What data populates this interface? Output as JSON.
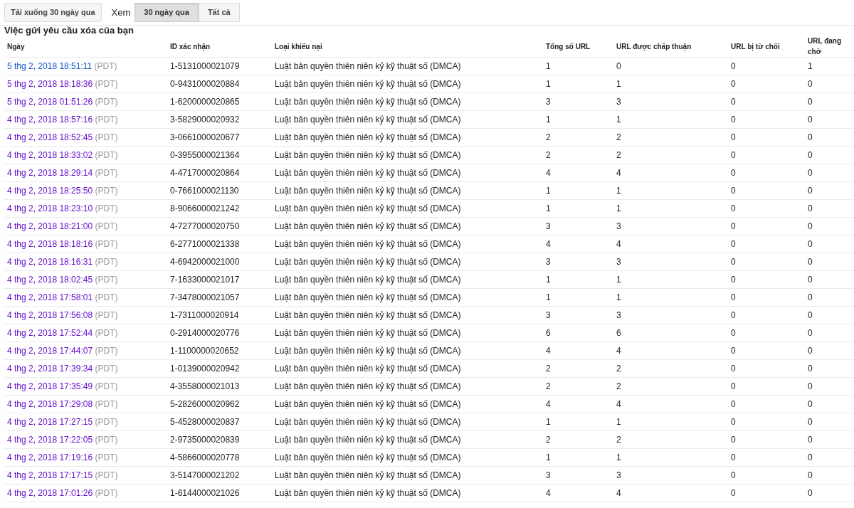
{
  "toolbar": {
    "download_button": "Tải xuống 30 ngày qua",
    "view_label": "Xem",
    "view_options": [
      {
        "label": "30 ngày qua",
        "selected": true
      },
      {
        "label": "Tất cả",
        "selected": false
      }
    ]
  },
  "section_title": "Việc gửi yêu cầu xóa của bạn",
  "table": {
    "columns": [
      "Ngày",
      "ID xác nhận",
      "Loại khiếu nại",
      "Tổng số URL",
      "URL được chấp thuận",
      "URL bị từ chối",
      "URL đang chờ"
    ],
    "rows": [
      {
        "date": "5 thg 2, 2018 18:51:11",
        "zone": "(PDT)",
        "visited": false,
        "id": "1-5131000021079",
        "type": "Luật bản quyền thiên niên kỷ kỹ thuật số (DMCA)",
        "total": "1",
        "approved": "0",
        "rejected": "0",
        "pending": "1"
      },
      {
        "date": "5 thg 2, 2018 18:18:36",
        "zone": "(PDT)",
        "visited": true,
        "id": "0-9431000020884",
        "type": "Luật bản quyền thiên niên kỷ kỹ thuật số (DMCA)",
        "total": "1",
        "approved": "1",
        "rejected": "0",
        "pending": "0"
      },
      {
        "date": "5 thg 2, 2018 01:51:26",
        "zone": "(PDT)",
        "visited": true,
        "id": "1-6200000020865",
        "type": "Luật bản quyền thiên niên kỷ kỹ thuật số (DMCA)",
        "total": "3",
        "approved": "3",
        "rejected": "0",
        "pending": "0"
      },
      {
        "date": "4 thg 2, 2018 18:57:16",
        "zone": "(PDT)",
        "visited": true,
        "id": "3-5829000020932",
        "type": "Luật bản quyền thiên niên kỷ kỹ thuật số (DMCA)",
        "total": "1",
        "approved": "1",
        "rejected": "0",
        "pending": "0"
      },
      {
        "date": "4 thg 2, 2018 18:52:45",
        "zone": "(PDT)",
        "visited": true,
        "id": "3-0661000020677",
        "type": "Luật bản quyền thiên niên kỷ kỹ thuật số (DMCA)",
        "total": "2",
        "approved": "2",
        "rejected": "0",
        "pending": "0"
      },
      {
        "date": "4 thg 2, 2018 18:33:02",
        "zone": "(PDT)",
        "visited": true,
        "id": "0-3955000021364",
        "type": "Luật bản quyền thiên niên kỷ kỹ thuật số (DMCA)",
        "total": "2",
        "approved": "2",
        "rejected": "0",
        "pending": "0"
      },
      {
        "date": "4 thg 2, 2018 18:29:14",
        "zone": "(PDT)",
        "visited": true,
        "id": "4-4717000020864",
        "type": "Luật bản quyền thiên niên kỷ kỹ thuật số (DMCA)",
        "total": "4",
        "approved": "4",
        "rejected": "0",
        "pending": "0"
      },
      {
        "date": "4 thg 2, 2018 18:25:50",
        "zone": "(PDT)",
        "visited": true,
        "id": "0-7661000021130",
        "type": "Luật bản quyền thiên niên kỷ kỹ thuật số (DMCA)",
        "total": "1",
        "approved": "1",
        "rejected": "0",
        "pending": "0"
      },
      {
        "date": "4 thg 2, 2018 18:23:10",
        "zone": "(PDT)",
        "visited": true,
        "id": "8-9066000021242",
        "type": "Luật bản quyền thiên niên kỷ kỹ thuật số (DMCA)",
        "total": "1",
        "approved": "1",
        "rejected": "0",
        "pending": "0"
      },
      {
        "date": "4 thg 2, 2018 18:21:00",
        "zone": "(PDT)",
        "visited": true,
        "id": "4-7277000020750",
        "type": "Luật bản quyền thiên niên kỷ kỹ thuật số (DMCA)",
        "total": "3",
        "approved": "3",
        "rejected": "0",
        "pending": "0"
      },
      {
        "date": "4 thg 2, 2018 18:18:16",
        "zone": "(PDT)",
        "visited": true,
        "id": "6-2771000021338",
        "type": "Luật bản quyền thiên niên kỷ kỹ thuật số (DMCA)",
        "total": "4",
        "approved": "4",
        "rejected": "0",
        "pending": "0"
      },
      {
        "date": "4 thg 2, 2018 18:16:31",
        "zone": "(PDT)",
        "visited": true,
        "id": "4-6942000021000",
        "type": "Luật bản quyền thiên niên kỷ kỹ thuật số (DMCA)",
        "total": "3",
        "approved": "3",
        "rejected": "0",
        "pending": "0"
      },
      {
        "date": "4 thg 2, 2018 18:02:45",
        "zone": "(PDT)",
        "visited": true,
        "id": "7-1633000021017",
        "type": "Luật bản quyền thiên niên kỷ kỹ thuật số (DMCA)",
        "total": "1",
        "approved": "1",
        "rejected": "0",
        "pending": "0"
      },
      {
        "date": "4 thg 2, 2018 17:58:01",
        "zone": "(PDT)",
        "visited": true,
        "id": "7-3478000021057",
        "type": "Luật bản quyền thiên niên kỷ kỹ thuật số (DMCA)",
        "total": "1",
        "approved": "1",
        "rejected": "0",
        "pending": "0"
      },
      {
        "date": "4 thg 2, 2018 17:56:08",
        "zone": "(PDT)",
        "visited": true,
        "id": "1-7311000020914",
        "type": "Luật bản quyền thiên niên kỷ kỹ thuật số (DMCA)",
        "total": "3",
        "approved": "3",
        "rejected": "0",
        "pending": "0"
      },
      {
        "date": "4 thg 2, 2018 17:52:44",
        "zone": "(PDT)",
        "visited": true,
        "id": "0-2914000020776",
        "type": "Luật bản quyền thiên niên kỷ kỹ thuật số (DMCA)",
        "total": "6",
        "approved": "6",
        "rejected": "0",
        "pending": "0"
      },
      {
        "date": "4 thg 2, 2018 17:44:07",
        "zone": "(PDT)",
        "visited": true,
        "id": "1-1100000020652",
        "type": "Luật bản quyền thiên niên kỷ kỹ thuật số (DMCA)",
        "total": "4",
        "approved": "4",
        "rejected": "0",
        "pending": "0"
      },
      {
        "date": "4 thg 2, 2018 17:39:34",
        "zone": "(PDT)",
        "visited": true,
        "id": "1-0139000020942",
        "type": "Luật bản quyền thiên niên kỷ kỹ thuật số (DMCA)",
        "total": "2",
        "approved": "2",
        "rejected": "0",
        "pending": "0"
      },
      {
        "date": "4 thg 2, 2018 17:35:49",
        "zone": "(PDT)",
        "visited": true,
        "id": "4-3558000021013",
        "type": "Luật bản quyền thiên niên kỷ kỹ thuật số (DMCA)",
        "total": "2",
        "approved": "2",
        "rejected": "0",
        "pending": "0"
      },
      {
        "date": "4 thg 2, 2018 17:29:08",
        "zone": "(PDT)",
        "visited": true,
        "id": "5-2826000020962",
        "type": "Luật bản quyền thiên niên kỷ kỹ thuật số (DMCA)",
        "total": "4",
        "approved": "4",
        "rejected": "0",
        "pending": "0"
      },
      {
        "date": "4 thg 2, 2018 17:27:15",
        "zone": "(PDT)",
        "visited": true,
        "id": "5-4528000020837",
        "type": "Luật bản quyền thiên niên kỷ kỹ thuật số (DMCA)",
        "total": "1",
        "approved": "1",
        "rejected": "0",
        "pending": "0"
      },
      {
        "date": "4 thg 2, 2018 17:22:05",
        "zone": "(PDT)",
        "visited": true,
        "id": "2-9735000020839",
        "type": "Luật bản quyền thiên niên kỷ kỹ thuật số (DMCA)",
        "total": "2",
        "approved": "2",
        "rejected": "0",
        "pending": "0"
      },
      {
        "date": "4 thg 2, 2018 17:19:16",
        "zone": "(PDT)",
        "visited": true,
        "id": "4-5866000020778",
        "type": "Luật bản quyền thiên niên kỷ kỹ thuật số (DMCA)",
        "total": "1",
        "approved": "1",
        "rejected": "0",
        "pending": "0"
      },
      {
        "date": "4 thg 2, 2018 17:17:15",
        "zone": "(PDT)",
        "visited": true,
        "id": "3-5147000021202",
        "type": "Luật bản quyền thiên niên kỷ kỹ thuật số (DMCA)",
        "total": "3",
        "approved": "3",
        "rejected": "0",
        "pending": "0"
      },
      {
        "date": "4 thg 2, 2018 17:01:26",
        "zone": "(PDT)",
        "visited": true,
        "id": "1-6144000021026",
        "type": "Luật bản quyền thiên niên kỷ kỹ thuật số (DMCA)",
        "total": "4",
        "approved": "4",
        "rejected": "0",
        "pending": "0"
      }
    ]
  }
}
